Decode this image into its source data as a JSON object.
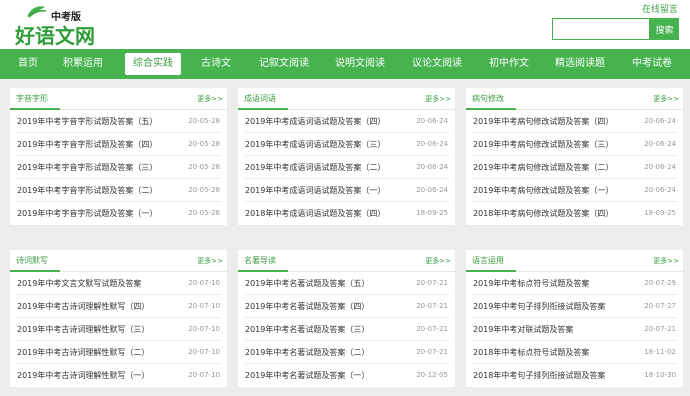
{
  "header": {
    "logo_sub": "中考版",
    "logo_main": "好语文网",
    "online_link": "在线留言",
    "search_placeholder": "",
    "search_button": "搜索",
    "accent": "#46b34f"
  },
  "nav": {
    "items": [
      {
        "label": "首页"
      },
      {
        "label": "积累运用"
      },
      {
        "label": "综合实践"
      },
      {
        "label": "古诗文"
      },
      {
        "label": "记叙文阅读"
      },
      {
        "label": "说明文阅读"
      },
      {
        "label": "议论文阅读"
      },
      {
        "label": "初中作文"
      },
      {
        "label": "精选阅读题"
      },
      {
        "label": "中考试卷"
      }
    ],
    "active": "综合实践"
  },
  "panels": [
    {
      "title": "字音字形",
      "more": "更多>>",
      "rows": [
        {
          "title": "2019年中考字音字形试题及答案（五）",
          "date": "20-05-28"
        },
        {
          "title": "2019年中考字音字形试题及答案（四）",
          "date": "20-05-28"
        },
        {
          "title": "2019年中考字音字形试题及答案（三）",
          "date": "20-05-28"
        },
        {
          "title": "2019年中考字音字形试题及答案（二）",
          "date": "20-05-28"
        },
        {
          "title": "2019年中考字音字形试题及答案（一）",
          "date": "20-05-28"
        }
      ]
    },
    {
      "title": "成语词语",
      "more": "更多>>",
      "rows": [
        {
          "title": "2019年中考成语词语试题及答案（四）",
          "date": "20-06-24"
        },
        {
          "title": "2019年中考成语词语试题及答案（三）",
          "date": "20-06-24"
        },
        {
          "title": "2019年中考成语词语试题及答案（二）",
          "date": "20-06-24"
        },
        {
          "title": "2019年中考成语词语试题及答案（一）",
          "date": "20-06-24"
        },
        {
          "title": "2018年中考成语词语试题及答案（四）",
          "date": "18-09-25"
        }
      ]
    },
    {
      "title": "病句修改",
      "more": "更多>>",
      "rows": [
        {
          "title": "2019年中考病句修改试题及答案（四）",
          "date": "20-06-24"
        },
        {
          "title": "2019年中考病句修改试题及答案（三）",
          "date": "20-06-24"
        },
        {
          "title": "2019年中考病句修改试题及答案（二）",
          "date": "20-06-24"
        },
        {
          "title": "2019年中考病句修改试题及答案（一）",
          "date": "20-06-24"
        },
        {
          "title": "2018年中考病句修改试题及答案（四）",
          "date": "18-09-25"
        }
      ]
    },
    {
      "title": "诗词默写",
      "more": "更多>>",
      "rows": [
        {
          "title": "2019年中考文言文默写试题及答案",
          "date": "20-07-10"
        },
        {
          "title": "2019年中考古诗词理解性默写（四）",
          "date": "20-07-10"
        },
        {
          "title": "2019年中考古诗词理解性默写（三）",
          "date": "20-07-10"
        },
        {
          "title": "2019年中考古诗词理解性默写（二）",
          "date": "20-07-10"
        },
        {
          "title": "2019年中考古诗词理解性默写（一）",
          "date": "20-07-10"
        }
      ]
    },
    {
      "title": "名著导读",
      "more": "更多>>",
      "rows": [
        {
          "title": "2019年中考名著试题及答案（五）",
          "date": "20-07-21"
        },
        {
          "title": "2019年中考名著试题及答案（四）",
          "date": "20-07-21"
        },
        {
          "title": "2019年中考名著试题及答案（三）",
          "date": "20-07-21"
        },
        {
          "title": "2019年中考名著试题及答案（二）",
          "date": "20-07-21"
        },
        {
          "title": "2019年中考名著试题及答案（一）",
          "date": "20-12-05"
        }
      ]
    },
    {
      "title": "语言运用",
      "more": "更多>>",
      "rows": [
        {
          "title": "2019年中考标点符号试题及答案",
          "date": "20-07-29"
        },
        {
          "title": "2019年中考句子排列衔接试题及答案",
          "date": "20-07-27"
        },
        {
          "title": "2019年中考对联试题及答案",
          "date": "20-07-21"
        },
        {
          "title": "2018年中考标点符号试题及答案",
          "date": "18-11-02"
        },
        {
          "title": "2018年中考句子排列衔接试题及答案",
          "date": "18-10-30"
        }
      ]
    }
  ]
}
